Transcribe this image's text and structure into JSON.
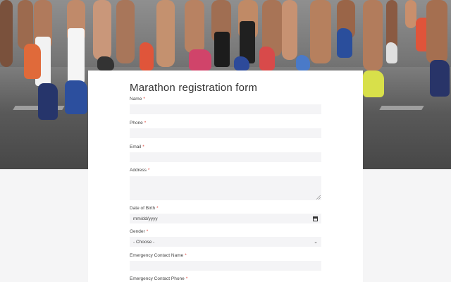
{
  "form": {
    "title": "Marathon registration form",
    "required_mark": "*",
    "fields": {
      "name": {
        "label": "Name"
      },
      "phone": {
        "label": "Phone"
      },
      "email": {
        "label": "Email"
      },
      "address": {
        "label": "Address"
      },
      "dob": {
        "label": "Date of Birth",
        "placeholder": "mm/dd/yyyy"
      },
      "gender": {
        "label": "Gender",
        "selected": "- Choose -"
      },
      "emergency_name": {
        "label": "Emergency Contact Name"
      },
      "emergency_phone": {
        "label": "Emergency Contact Phone"
      }
    }
  },
  "colors": {
    "required": "#e0463b",
    "field_bg": "#f4f4f6",
    "page_bg": "#f5f5f6"
  },
  "icons": {
    "date_picker": "calendar-icon",
    "select": "chevron-down-icon"
  }
}
